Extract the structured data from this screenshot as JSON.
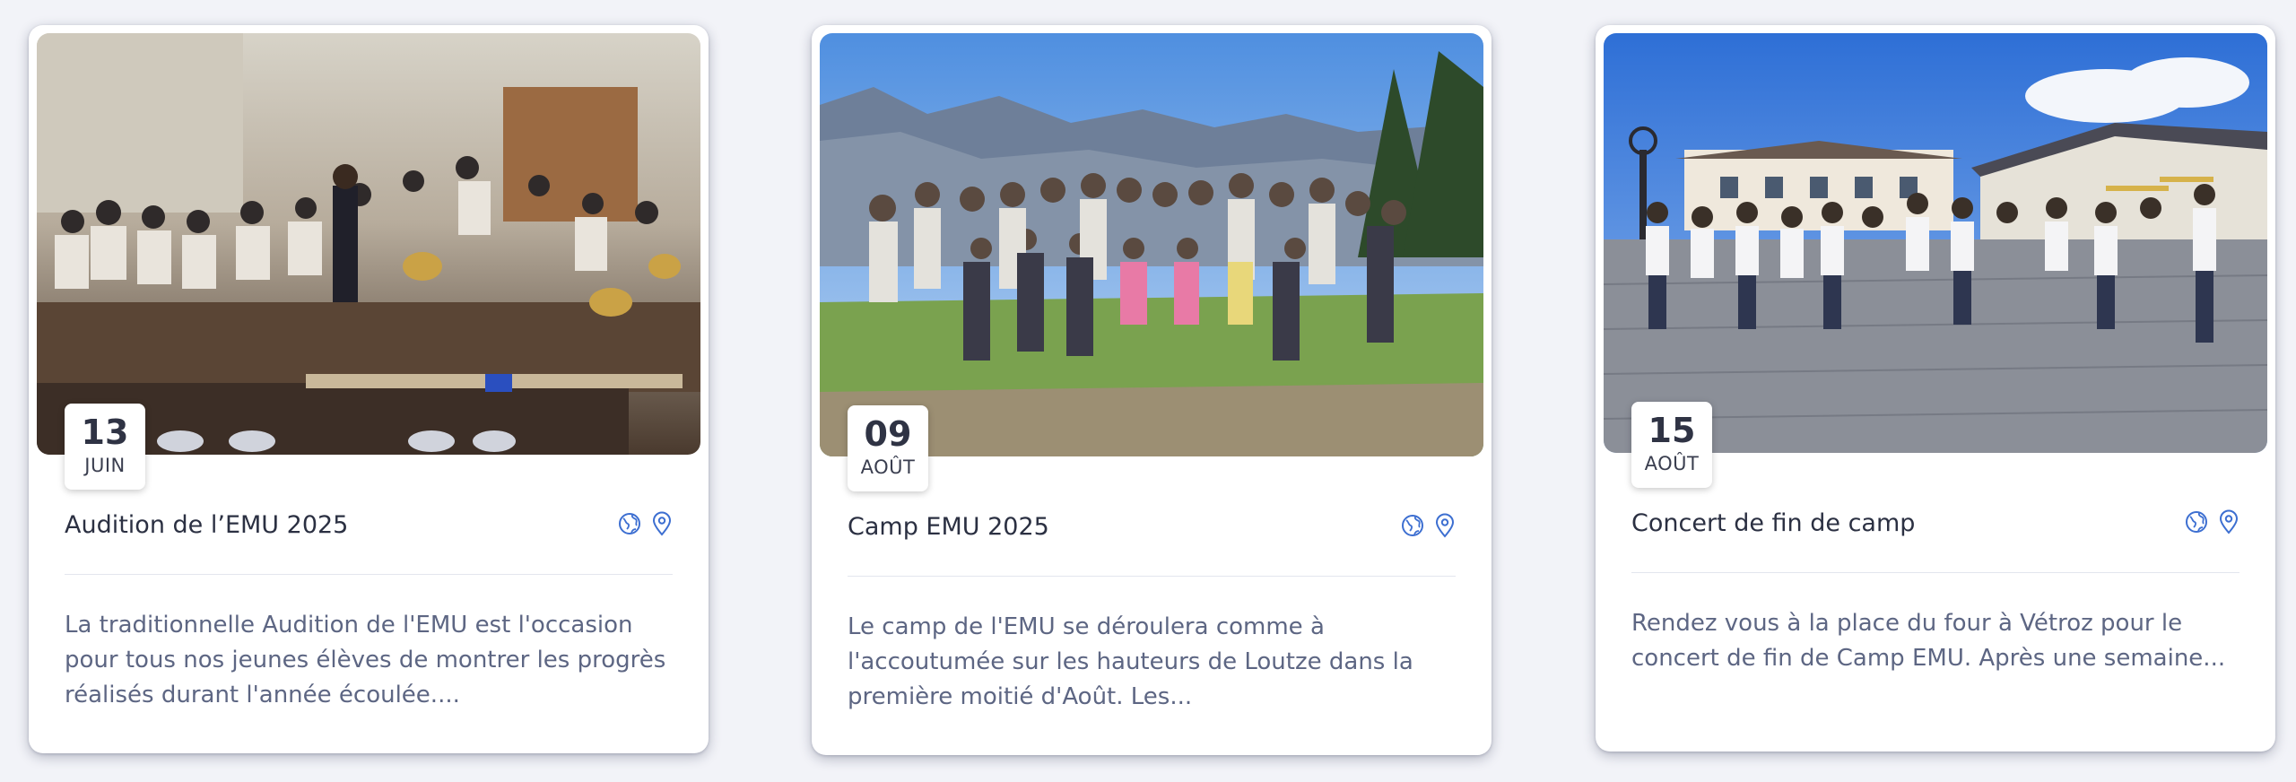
{
  "events": [
    {
      "day": "13",
      "month": "JUIN",
      "title": "Audition de l’EMU 2025",
      "description_lines": [
        "La traditionnelle Audition de l'EMU est l'occasion",
        "pour tous nos jeunes élèves de montrer les progrès",
        "réalisés durant l'année écoulée...."
      ],
      "icons": [
        "globe-icon",
        "map-pin-icon"
      ]
    },
    {
      "day": "09",
      "month": "AOÛT",
      "title": "Camp EMU 2025",
      "description_lines": [
        "Le camp de l'EMU se déroulera comme à",
        "l'accoutumée sur les hauteurs de Loutze dans la",
        "première moitié d'Août. Les..."
      ],
      "icons": [
        "globe-icon",
        "map-pin-icon"
      ]
    },
    {
      "day": "15",
      "month": "AOÛT",
      "title": "Concert de fin de camp",
      "description_lines": [
        "Rendez vous à la place du four à Vétroz pour le",
        "concert de fin de Camp EMU. Après une semaine..."
      ],
      "icons": [
        "globe-icon",
        "map-pin-icon"
      ]
    }
  ],
  "colors": {
    "icon_blue": "#3d6fd1",
    "page_background": "#f2f3f8",
    "title_text": "#2b3042",
    "description_text": "#5d6683"
  }
}
